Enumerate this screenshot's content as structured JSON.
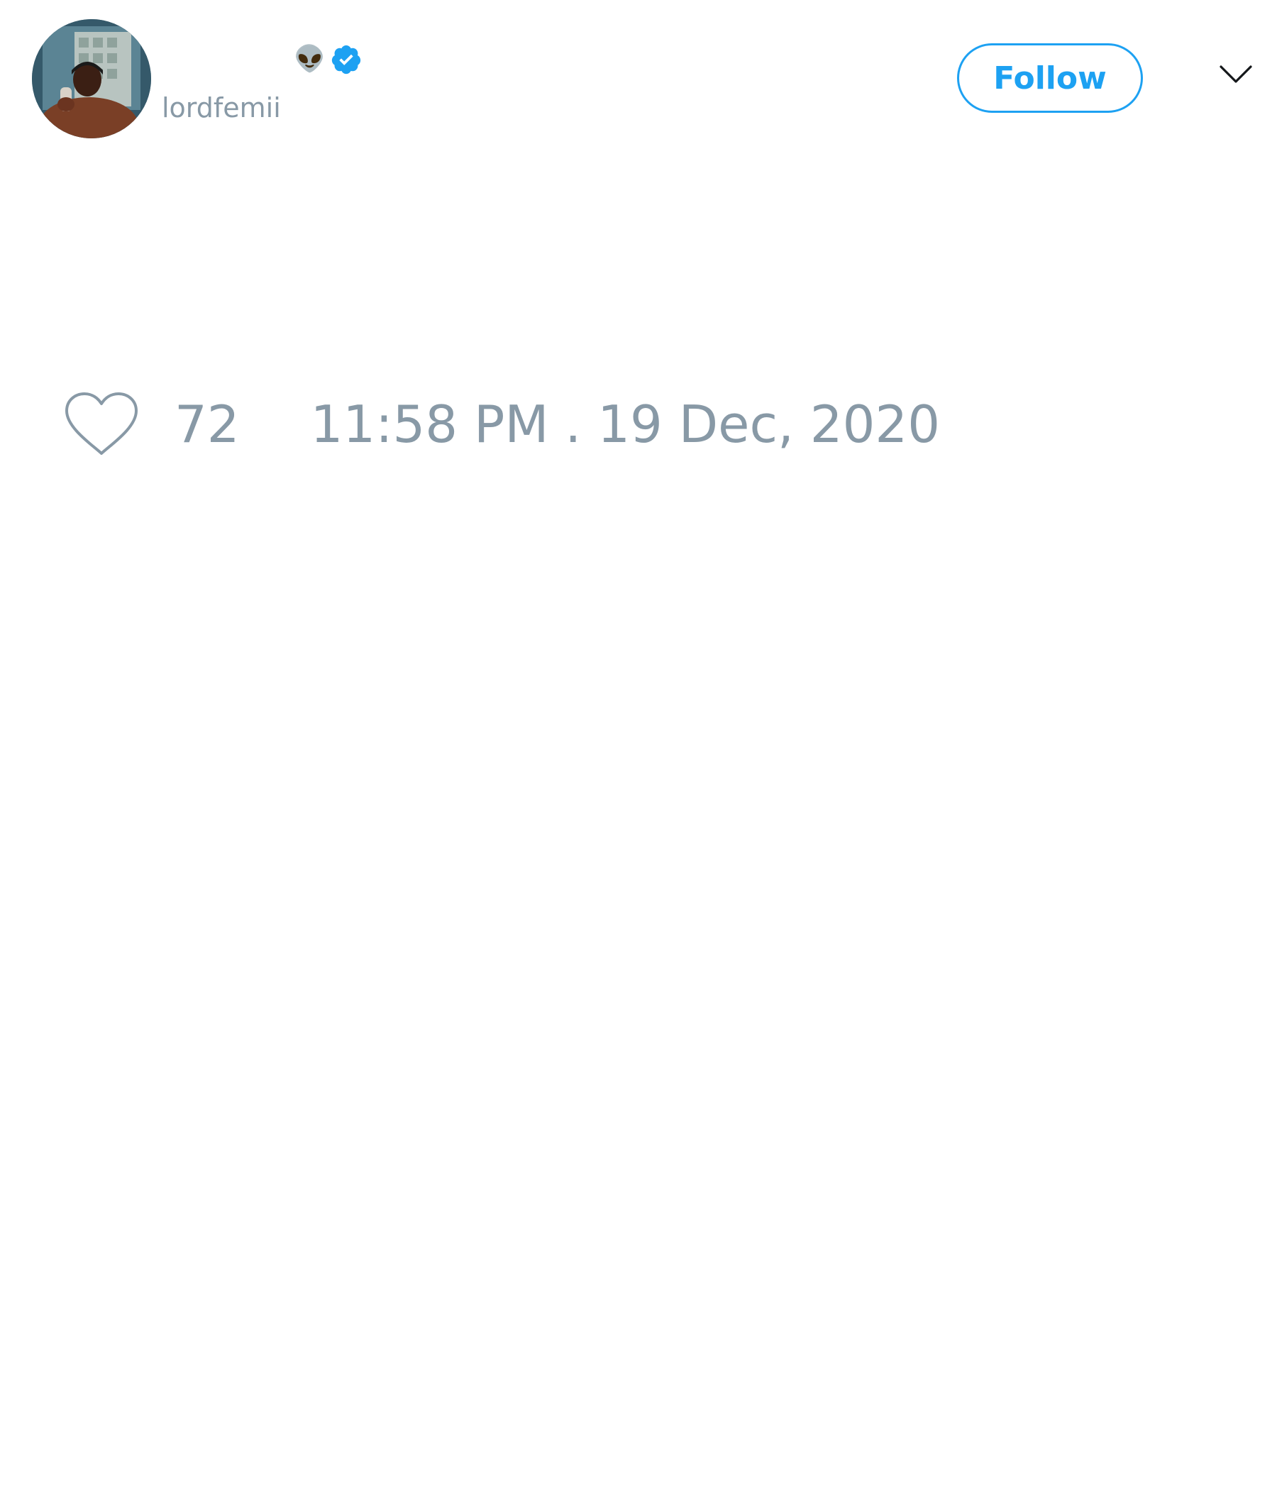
{
  "author": {
    "handle": "lordfemii",
    "name_emoji": "👽",
    "verified_icon": "verified-badge-icon"
  },
  "header": {
    "follow_label": "Follow",
    "menu_icon": "chevron-down-icon"
  },
  "tweet": {
    "like_icon": "heart-outline-icon",
    "like_count": "72",
    "timestamp": "11:58 PM . 19 Dec, 2020"
  },
  "colors": {
    "accent": "#1da1f2",
    "muted_text": "#8899a6",
    "background": "#ffffff"
  }
}
